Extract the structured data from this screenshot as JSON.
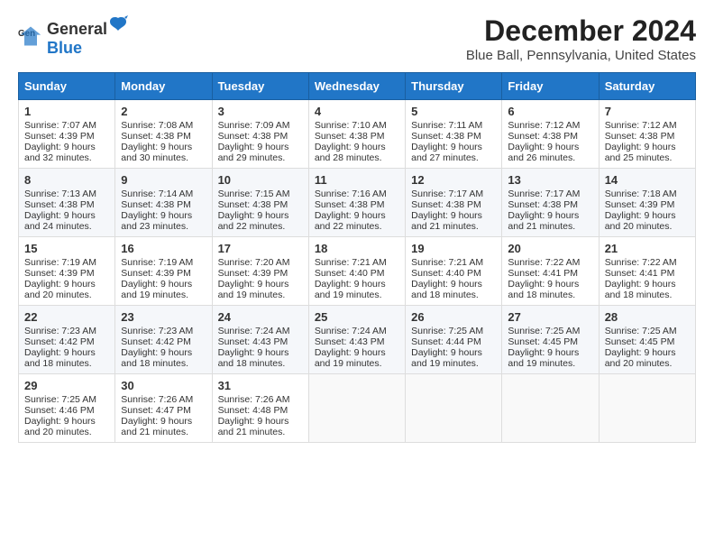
{
  "logo": {
    "general": "General",
    "blue": "Blue"
  },
  "title": "December 2024",
  "subtitle": "Blue Ball, Pennsylvania, United States",
  "calendar": {
    "headers": [
      "Sunday",
      "Monday",
      "Tuesday",
      "Wednesday",
      "Thursday",
      "Friday",
      "Saturday"
    ],
    "rows": [
      [
        {
          "day": "1",
          "sunrise": "Sunrise: 7:07 AM",
          "sunset": "Sunset: 4:39 PM",
          "daylight": "Daylight: 9 hours and 32 minutes."
        },
        {
          "day": "2",
          "sunrise": "Sunrise: 7:08 AM",
          "sunset": "Sunset: 4:38 PM",
          "daylight": "Daylight: 9 hours and 30 minutes."
        },
        {
          "day": "3",
          "sunrise": "Sunrise: 7:09 AM",
          "sunset": "Sunset: 4:38 PM",
          "daylight": "Daylight: 9 hours and 29 minutes."
        },
        {
          "day": "4",
          "sunrise": "Sunrise: 7:10 AM",
          "sunset": "Sunset: 4:38 PM",
          "daylight": "Daylight: 9 hours and 28 minutes."
        },
        {
          "day": "5",
          "sunrise": "Sunrise: 7:11 AM",
          "sunset": "Sunset: 4:38 PM",
          "daylight": "Daylight: 9 hours and 27 minutes."
        },
        {
          "day": "6",
          "sunrise": "Sunrise: 7:12 AM",
          "sunset": "Sunset: 4:38 PM",
          "daylight": "Daylight: 9 hours and 26 minutes."
        },
        {
          "day": "7",
          "sunrise": "Sunrise: 7:12 AM",
          "sunset": "Sunset: 4:38 PM",
          "daylight": "Daylight: 9 hours and 25 minutes."
        }
      ],
      [
        {
          "day": "8",
          "sunrise": "Sunrise: 7:13 AM",
          "sunset": "Sunset: 4:38 PM",
          "daylight": "Daylight: 9 hours and 24 minutes."
        },
        {
          "day": "9",
          "sunrise": "Sunrise: 7:14 AM",
          "sunset": "Sunset: 4:38 PM",
          "daylight": "Daylight: 9 hours and 23 minutes."
        },
        {
          "day": "10",
          "sunrise": "Sunrise: 7:15 AM",
          "sunset": "Sunset: 4:38 PM",
          "daylight": "Daylight: 9 hours and 22 minutes."
        },
        {
          "day": "11",
          "sunrise": "Sunrise: 7:16 AM",
          "sunset": "Sunset: 4:38 PM",
          "daylight": "Daylight: 9 hours and 22 minutes."
        },
        {
          "day": "12",
          "sunrise": "Sunrise: 7:17 AM",
          "sunset": "Sunset: 4:38 PM",
          "daylight": "Daylight: 9 hours and 21 minutes."
        },
        {
          "day": "13",
          "sunrise": "Sunrise: 7:17 AM",
          "sunset": "Sunset: 4:38 PM",
          "daylight": "Daylight: 9 hours and 21 minutes."
        },
        {
          "day": "14",
          "sunrise": "Sunrise: 7:18 AM",
          "sunset": "Sunset: 4:39 PM",
          "daylight": "Daylight: 9 hours and 20 minutes."
        }
      ],
      [
        {
          "day": "15",
          "sunrise": "Sunrise: 7:19 AM",
          "sunset": "Sunset: 4:39 PM",
          "daylight": "Daylight: 9 hours and 20 minutes."
        },
        {
          "day": "16",
          "sunrise": "Sunrise: 7:19 AM",
          "sunset": "Sunset: 4:39 PM",
          "daylight": "Daylight: 9 hours and 19 minutes."
        },
        {
          "day": "17",
          "sunrise": "Sunrise: 7:20 AM",
          "sunset": "Sunset: 4:39 PM",
          "daylight": "Daylight: 9 hours and 19 minutes."
        },
        {
          "day": "18",
          "sunrise": "Sunrise: 7:21 AM",
          "sunset": "Sunset: 4:40 PM",
          "daylight": "Daylight: 9 hours and 19 minutes."
        },
        {
          "day": "19",
          "sunrise": "Sunrise: 7:21 AM",
          "sunset": "Sunset: 4:40 PM",
          "daylight": "Daylight: 9 hours and 18 minutes."
        },
        {
          "day": "20",
          "sunrise": "Sunrise: 7:22 AM",
          "sunset": "Sunset: 4:41 PM",
          "daylight": "Daylight: 9 hours and 18 minutes."
        },
        {
          "day": "21",
          "sunrise": "Sunrise: 7:22 AM",
          "sunset": "Sunset: 4:41 PM",
          "daylight": "Daylight: 9 hours and 18 minutes."
        }
      ],
      [
        {
          "day": "22",
          "sunrise": "Sunrise: 7:23 AM",
          "sunset": "Sunset: 4:42 PM",
          "daylight": "Daylight: 9 hours and 18 minutes."
        },
        {
          "day": "23",
          "sunrise": "Sunrise: 7:23 AM",
          "sunset": "Sunset: 4:42 PM",
          "daylight": "Daylight: 9 hours and 18 minutes."
        },
        {
          "day": "24",
          "sunrise": "Sunrise: 7:24 AM",
          "sunset": "Sunset: 4:43 PM",
          "daylight": "Daylight: 9 hours and 18 minutes."
        },
        {
          "day": "25",
          "sunrise": "Sunrise: 7:24 AM",
          "sunset": "Sunset: 4:43 PM",
          "daylight": "Daylight: 9 hours and 19 minutes."
        },
        {
          "day": "26",
          "sunrise": "Sunrise: 7:25 AM",
          "sunset": "Sunset: 4:44 PM",
          "daylight": "Daylight: 9 hours and 19 minutes."
        },
        {
          "day": "27",
          "sunrise": "Sunrise: 7:25 AM",
          "sunset": "Sunset: 4:45 PM",
          "daylight": "Daylight: 9 hours and 19 minutes."
        },
        {
          "day": "28",
          "sunrise": "Sunrise: 7:25 AM",
          "sunset": "Sunset: 4:45 PM",
          "daylight": "Daylight: 9 hours and 20 minutes."
        }
      ],
      [
        {
          "day": "29",
          "sunrise": "Sunrise: 7:25 AM",
          "sunset": "Sunset: 4:46 PM",
          "daylight": "Daylight: 9 hours and 20 minutes."
        },
        {
          "day": "30",
          "sunrise": "Sunrise: 7:26 AM",
          "sunset": "Sunset: 4:47 PM",
          "daylight": "Daylight: 9 hours and 21 minutes."
        },
        {
          "day": "31",
          "sunrise": "Sunrise: 7:26 AM",
          "sunset": "Sunset: 4:48 PM",
          "daylight": "Daylight: 9 hours and 21 minutes."
        },
        null,
        null,
        null,
        null
      ]
    ]
  }
}
